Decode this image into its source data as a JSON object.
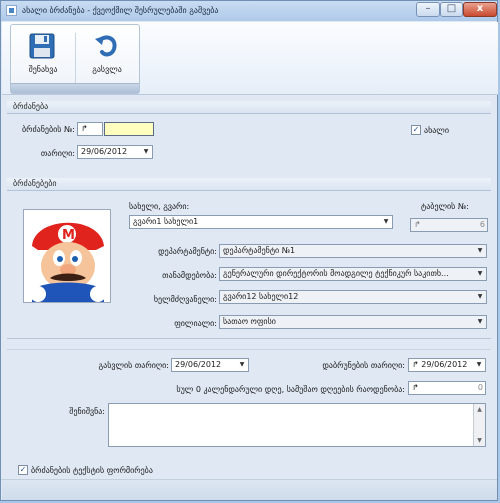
{
  "window": {
    "title": "ახალი ბრძანება - ქვეოქმილ შესრულებაში გაშვება",
    "minimize_symbol": "–",
    "maximize_symbol": "□",
    "close_symbol": "x"
  },
  "toolbar": {
    "save_label": "შენახვა",
    "exit_label": "გასვლა"
  },
  "orders_section": {
    "title": "ბრძანება",
    "number_label": "ბრძანების №:",
    "number_value": "",
    "number_icon": "↱",
    "date_label": "თარიღი:",
    "date_value": "29/06/2012",
    "new_label": "ახალი",
    "new_checked": true
  },
  "commands_section": {
    "title": "ბრძანებები",
    "name_label": "სახელი, გვარი:",
    "name_value": "გვარი1 სახელი1",
    "tabel_label": "ტაბელის №:",
    "tabel_value": "6",
    "tabel_icon": "↱",
    "dept_label": "დეპარტამენტი:",
    "dept_value": "დეპარტამენტი №1",
    "position_label": "თანამდებობა:",
    "position_value": "გენერალური დირექტორის მოადგილე ტექნიკურ საკითხ...",
    "manager_label": "ხელმძღვანელი:",
    "manager_value": "გვარი12 სახელი12",
    "branch_label": "ფილიალი:",
    "branch_value": "სათაო ოფისი"
  },
  "details": {
    "leave_date_label": "გასვლის თარიღი:",
    "leave_date_value": "29/06/2012",
    "return_date_label": "დაბრუნების თარიღი:",
    "return_date_value": "29/06/2012",
    "return_icon": "↱",
    "days_text": "სულ 0 კალენდარული დღე, სამუშაო დღეების რაოდენობა:",
    "days_value": "0",
    "days_icon": "↱",
    "note_label": "შენიშვნა:",
    "note_value": "",
    "form_text_label": "ბრძანების ტექსტის ფორმირება",
    "form_text_checked": true
  },
  "colors": {
    "window_bg": "#dfe8f3",
    "titlebar": "#aecaea",
    "accent": "#2a54a0",
    "highlight_field": "#ffffc0"
  },
  "icons": {
    "save": "floppy-disk-icon",
    "exit": "undo-arrow-icon",
    "check": "✓",
    "dropdown": "▼",
    "scroll_up": "▲",
    "scroll_down": "▼"
  }
}
